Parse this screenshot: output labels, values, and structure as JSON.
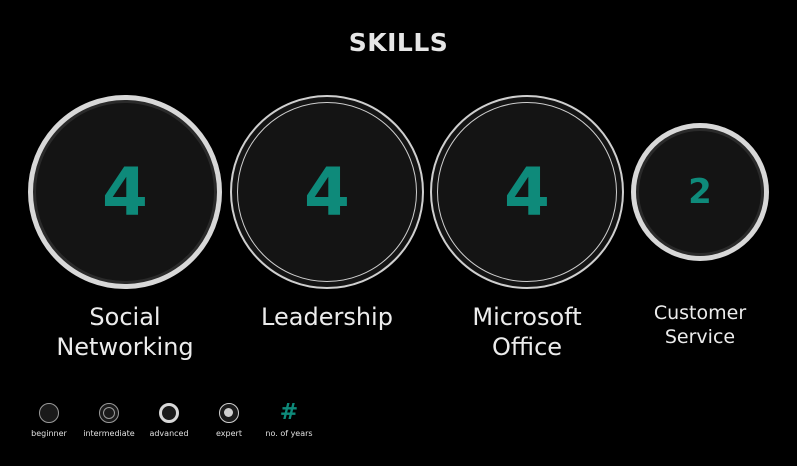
{
  "header": {
    "title": "SKILLS"
  },
  "skills": [
    {
      "name_line1": "Social",
      "name_line2": "Networking",
      "years": "4",
      "level": "advanced"
    },
    {
      "name_line1": "Leadership",
      "name_line2": "",
      "years": "4",
      "level": "expert"
    },
    {
      "name_line1": "Microsoft",
      "name_line2": "Office",
      "years": "4",
      "level": "expert"
    },
    {
      "name_line1": "Customer",
      "name_line2": "Service",
      "years": "2",
      "level": "advanced"
    }
  ],
  "legend": {
    "beginner": "beginner",
    "intermediate": "intermediate",
    "advanced": "advanced",
    "expert": "expert",
    "years_symbol": "#",
    "years": "no. of years"
  },
  "colors": {
    "background": "#000000",
    "accent": "#0e8a7a",
    "ring": "#d8d8d8",
    "circle_fill": "#141414"
  }
}
